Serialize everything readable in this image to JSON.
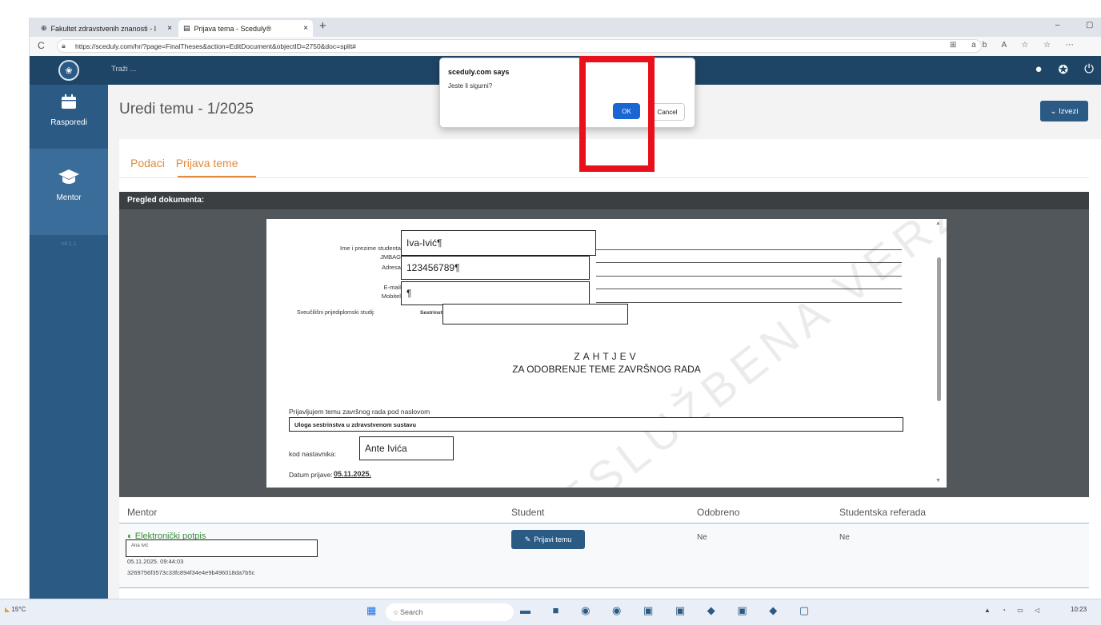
{
  "browser": {
    "tabs": [
      {
        "label": "Fakultet zdravstvenih znanosti - I",
        "icon": "globe-icon"
      },
      {
        "label": "Prijava tema - Sceduly®",
        "icon": "page-icon"
      }
    ],
    "tab_close": "×",
    "new_tab": "+",
    "window_min": "–",
    "window_restore": "▢",
    "reload": "C",
    "url": "https://sceduly.com/hr/?page=FinalTheses&action=EditDocument&objectID=2750&doc=split#",
    "toolbar_icons": "⊞ ab A ☆ ☆ ⋯"
  },
  "sidebar": {
    "items": [
      {
        "label": "Rasporedi",
        "icon": "calendar-icon"
      },
      {
        "label": "Mentor",
        "icon": "graduation-cap-icon"
      }
    ],
    "version": "v4.1.1"
  },
  "topbar": {
    "search_placeholder": "Traži ..."
  },
  "page": {
    "title": "Uredi temu - 1/2025",
    "export_button": "⌄ Izvezi",
    "tabs": [
      "Podaci",
      "Prijava teme"
    ],
    "viewer_header": "Pregled dokumenta:"
  },
  "document": {
    "fields": [
      {
        "label": "Ime i prezime studenta:",
        "value": "Iva-Ivić¶"
      },
      {
        "label": "JMBAG:",
        "value": ""
      },
      {
        "label": "Adresa:",
        "value": "123456789¶"
      },
      {
        "label": "E-mail:",
        "value": ""
      },
      {
        "label": "Mobitel:",
        "value": "¶"
      }
    ],
    "study_label": "Sveučilišni prijediplomski studij:",
    "study_value": "Sestrinstvo",
    "heading1": "ZAHTJEV",
    "heading2": "ZA ODOBRENJE TEME ZAVRŠNOG RADA",
    "intro": "Prijavljujem temu završnog rada pod naslovom",
    "thesis_title": "Uloga sestrinstva u zdravstvenom sustavu",
    "mentor_label": "kod nastavnika:",
    "mentor_value": "Ante Ivića",
    "date_label": "Datum prijave:",
    "date_value": "05.11.2025.",
    "watermark": "NESLUŽBENA VERZIJA"
  },
  "table": {
    "headers": [
      "Mentor",
      "Student",
      "Odobreno",
      "Studentska referada"
    ],
    "signature_link": "Elektronički potpis",
    "signature_name": "Ana Ivić",
    "signature_date": "05.11.2025. 09:44:03",
    "signature_hash": "3269756f3573c33fc894f34e4e9b496018da7b5c",
    "submit_button": "Prijavi temu",
    "approved": "Ne",
    "referada": "Ne"
  },
  "dialog": {
    "title": "sceduly.com says",
    "message": "Jeste li sigurni?",
    "ok": "OK",
    "cancel": "Cancel"
  },
  "taskbar": {
    "temperature": "15°C",
    "search": "Search",
    "time": "10:23"
  },
  "colors": {
    "brand": "#2b5b85",
    "accent": "#e08a3c",
    "highlight": "#e8101a",
    "ok_button": "#1a66d2"
  }
}
